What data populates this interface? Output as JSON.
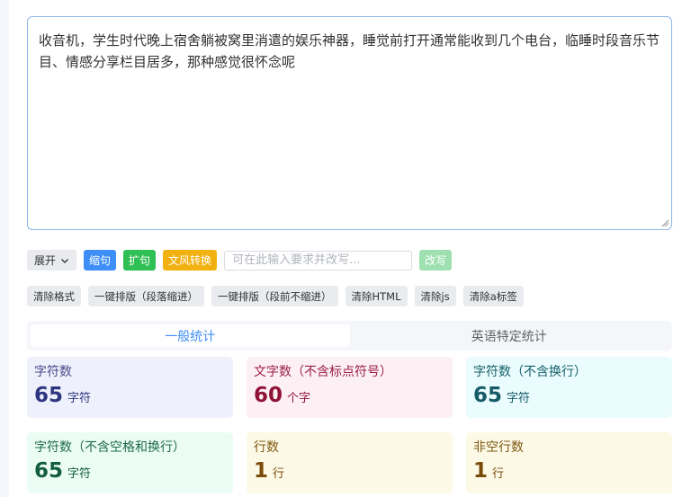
{
  "editor": {
    "content": "收音机，学生时代晚上宿舍躺被窝里消遣的娱乐神器，睡觉前打开通常能收到几个电台，临睡时段音乐节目、情感分享栏目居多，那种感觉很怀念呢"
  },
  "toolbar": {
    "expand_label": "展开",
    "shorten_label": "缩句",
    "expand_sentence_label": "扩句",
    "style_convert_label": "文风转换",
    "rewrite_placeholder": "可在此输入要求并改写...",
    "rewrite_label": "改写"
  },
  "format_toolbar": {
    "clear_format": "清除格式",
    "layout_indent": "一键排版（段落缩进）",
    "layout_no_indent": "一键排版（段前不缩进）",
    "clear_html": "清除HTML",
    "clear_js": "清除js",
    "clear_a": "清除a标签"
  },
  "tabs": [
    {
      "label": "一般统计",
      "active": true
    },
    {
      "label": "英语特定统计",
      "active": false
    }
  ],
  "stats": [
    {
      "label": "字符数",
      "value": "65",
      "unit": "字符"
    },
    {
      "label": "文字数（不含标点符号）",
      "value": "60",
      "unit": "个字"
    },
    {
      "label": "字符数（不含换行）",
      "value": "65",
      "unit": "字符"
    },
    {
      "label": "字符数（不含空格和换行）",
      "value": "65",
      "unit": "字符"
    },
    {
      "label": "行数",
      "value": "1",
      "unit": "行"
    },
    {
      "label": "非空行数",
      "value": "1",
      "unit": "行"
    }
  ],
  "colors": {
    "accent": "#3e8ef7",
    "green": "#2fbf55",
    "yellow": "#f1b110"
  }
}
